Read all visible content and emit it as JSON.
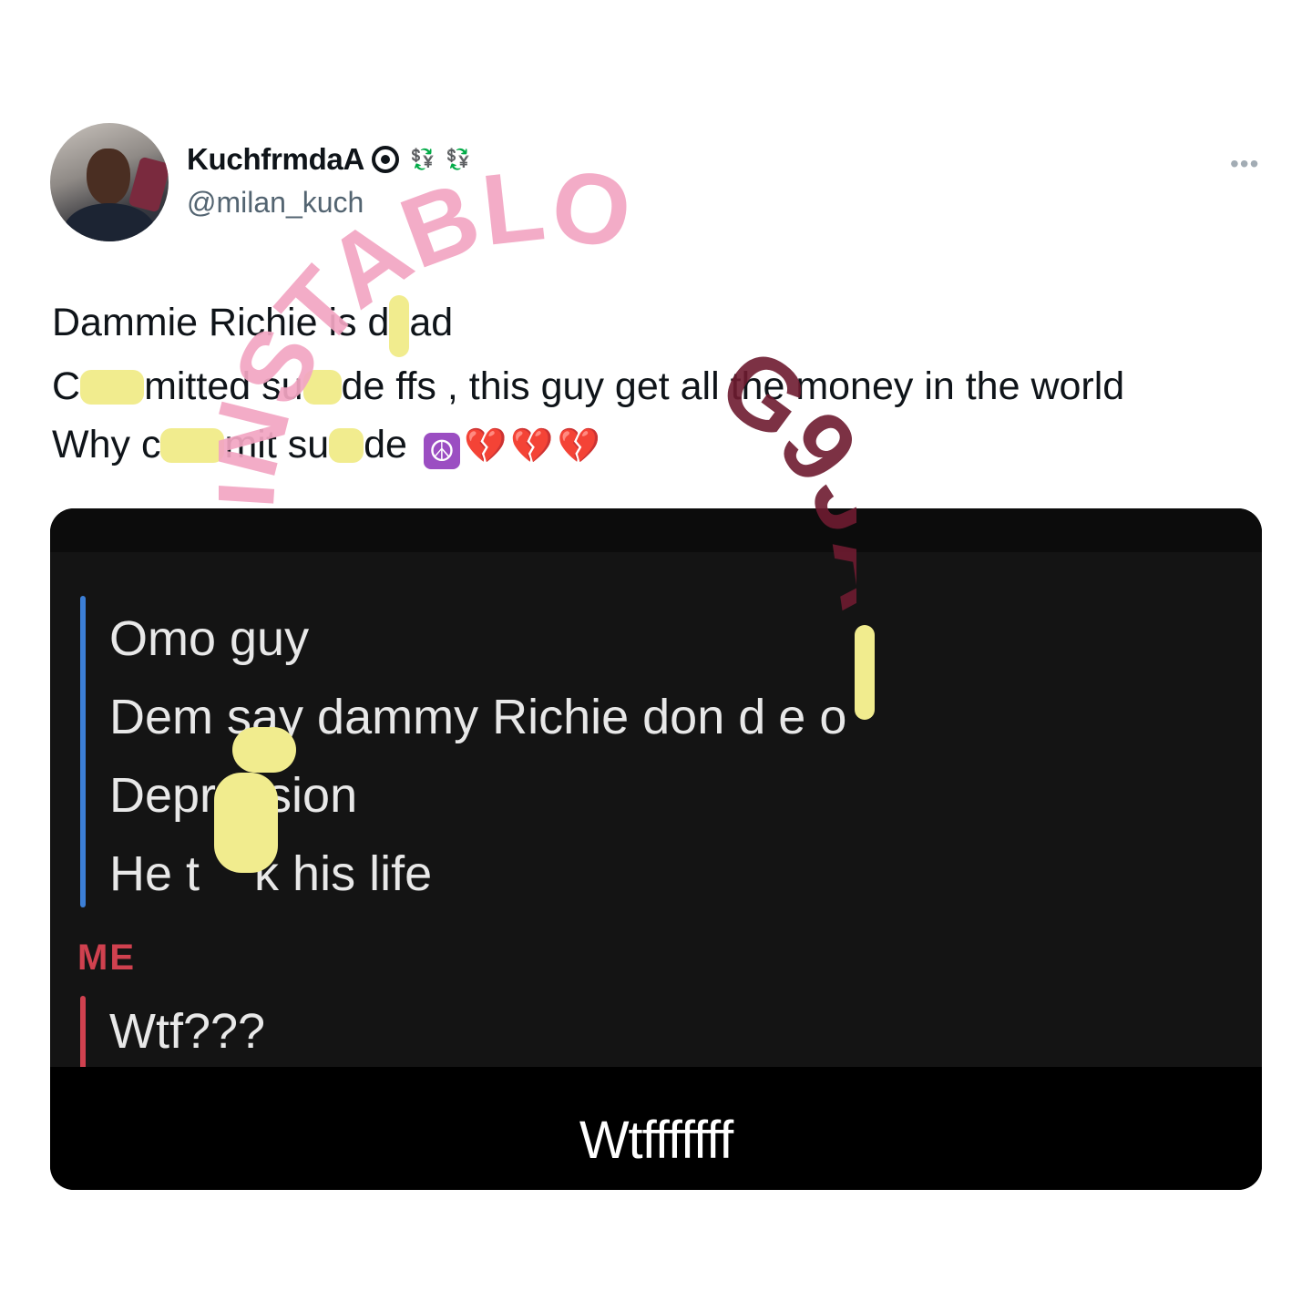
{
  "author": {
    "display_name": "KuchfrmdaA",
    "handle": "@milan_kuch",
    "name_emojis": [
      "eye-in-speech-bubble",
      "money-exchange",
      "money-exchange"
    ]
  },
  "tweet": {
    "lines": [
      [
        "Dammie Richie is d",
        "ad"
      ],
      [
        "C",
        "mitted su",
        "de ffs , this guy get all the money in the world"
      ],
      [
        "Why c",
        "mit su",
        "de"
      ]
    ],
    "trailing_emojis": [
      "peace-symbol",
      "broken-heart",
      "broken-heart",
      "broken-heart"
    ]
  },
  "media": {
    "quoted_lines": [
      "Omo guy",
      "Dem say dammy Richie don d",
      "e o",
      "Depr",
      "sion",
      "He t",
      "k his life"
    ],
    "me_label": "ME",
    "reply": "Wtf???",
    "caption": "Wtfffffff"
  },
  "watermark": {
    "text": "INSTABLOG9JA",
    "colors": {
      "light": "#f3a6c3",
      "dark": "#6e1b30"
    }
  },
  "colors": {
    "text": "#0f1419",
    "secondary_text": "#536471",
    "highlight": "#f1ec8e",
    "quote_bar": "#3c7fd6",
    "me_red": "#d0414f"
  }
}
